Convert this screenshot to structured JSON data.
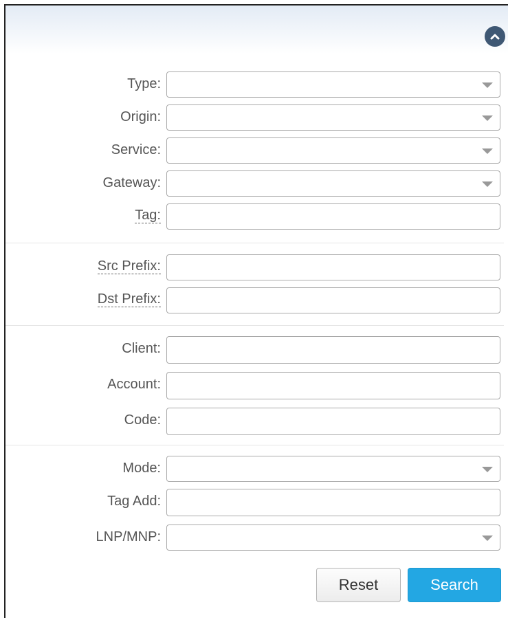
{
  "filters": {
    "type": {
      "label": "Type:",
      "value": ""
    },
    "origin": {
      "label": "Origin:",
      "value": ""
    },
    "service": {
      "label": "Service:",
      "value": ""
    },
    "gateway": {
      "label": "Gateway:",
      "value": ""
    },
    "tag": {
      "label": "Tag:",
      "value": ""
    },
    "src_prefix": {
      "label": "Src Prefix:",
      "value": ""
    },
    "dst_prefix": {
      "label": "Dst Prefix:",
      "value": ""
    },
    "client": {
      "label": "Client:",
      "value": ""
    },
    "account": {
      "label": "Account:",
      "value": ""
    },
    "code": {
      "label": "Code:",
      "value": ""
    },
    "mode": {
      "label": "Mode:",
      "value": ""
    },
    "tag_add": {
      "label": "Tag Add:",
      "value": ""
    },
    "lnp_mnp": {
      "label": "LNP/MNP:",
      "value": ""
    }
  },
  "buttons": {
    "reset": "Reset",
    "search": "Search"
  },
  "icons": {
    "collapse": "chevron-up-icon",
    "dropdown": "chevron-down-icon"
  },
  "colors": {
    "accent": "#23a7e3",
    "collapse_button": "#3f5874"
  }
}
